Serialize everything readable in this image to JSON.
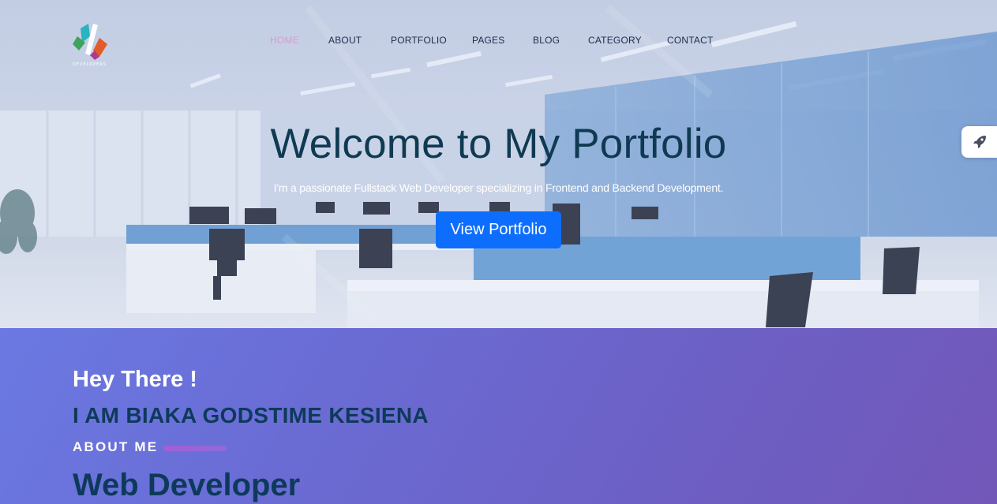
{
  "brand": {
    "caption": "DEVELOPERS"
  },
  "nav": {
    "items": [
      {
        "label": "HOME",
        "active": true
      },
      {
        "label": "ABOUT",
        "active": false
      },
      {
        "label": "PORTFOLIO",
        "active": false
      },
      {
        "label": "PAGES",
        "active": false
      },
      {
        "label": "BLOG",
        "active": false
      },
      {
        "label": "CATEGORY",
        "active": false
      },
      {
        "label": "CONTACT",
        "active": false
      }
    ]
  },
  "hero": {
    "title": "Welcome to My Portfolio",
    "subtitle_prefix": "I'm a passionate ",
    "subtitle_role": "Fullstack Web Developer",
    "subtitle_mid": " specializing in ",
    "subtitle_focus": "Frontend and Backend Development",
    "subtitle_suffix": ".",
    "button_label": "View Portfolio"
  },
  "side_widget": {
    "icon": "rocket-icon"
  },
  "about": {
    "greeting": "Hey There !",
    "name": "I AM BIAKA GODSTIME KESIENA",
    "label": "ABOUT ME",
    "role": "Web Developer"
  },
  "colors": {
    "nav_active": "#e794d4",
    "hero_title": "#0f3a52",
    "button": "#0d6efd",
    "about_gradient_start": "#6b79e2",
    "about_gradient_end": "#7257b8"
  }
}
